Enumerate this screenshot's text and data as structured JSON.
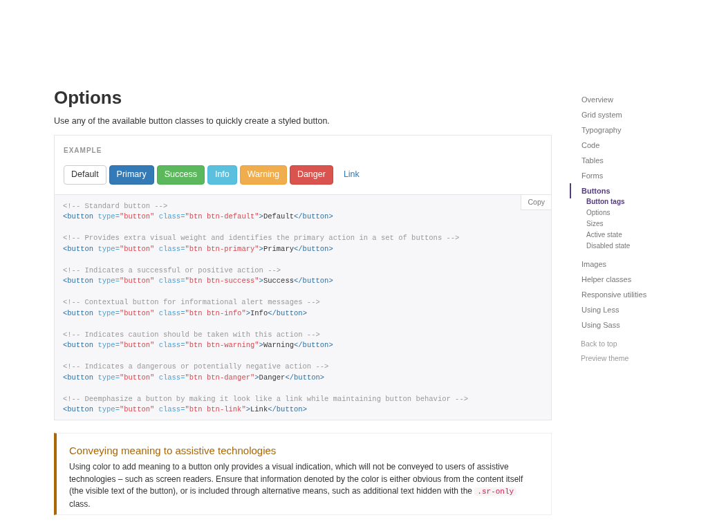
{
  "heading": "Options",
  "intro": "Use any of the available button classes to quickly create a styled button.",
  "example": {
    "label": "EXAMPLE",
    "buttons": [
      {
        "label": "Default",
        "kind": "default"
      },
      {
        "label": "Primary",
        "kind": "primary"
      },
      {
        "label": "Success",
        "kind": "success"
      },
      {
        "label": "Info",
        "kind": "info"
      },
      {
        "label": "Warning",
        "kind": "warning"
      },
      {
        "label": "Danger",
        "kind": "danger"
      },
      {
        "label": "Link",
        "kind": "link"
      }
    ]
  },
  "code": {
    "copy_label": "Copy",
    "blocks": [
      {
        "comment": "<!-- Standard button -->",
        "line": [
          {
            "kind": "tag",
            "text": "<button "
          },
          {
            "kind": "attr",
            "text": "type="
          },
          {
            "kind": "string",
            "text": "\"button\" "
          },
          {
            "kind": "attr",
            "text": "class="
          },
          {
            "kind": "string",
            "text": "\"btn btn-default\""
          },
          {
            "kind": "tag",
            "text": ">"
          },
          {
            "kind": "text",
            "text": "Default"
          },
          {
            "kind": "tag",
            "text": "</button>"
          }
        ]
      },
      {
        "comment": "<!-- Provides extra visual weight and identifies the primary action in a set of buttons -->",
        "line": [
          {
            "kind": "tag",
            "text": "<button "
          },
          {
            "kind": "attr",
            "text": "type="
          },
          {
            "kind": "string",
            "text": "\"button\" "
          },
          {
            "kind": "attr",
            "text": "class="
          },
          {
            "kind": "string",
            "text": "\"btn btn-primary\""
          },
          {
            "kind": "tag",
            "text": ">"
          },
          {
            "kind": "text",
            "text": "Primary"
          },
          {
            "kind": "tag",
            "text": "</button>"
          }
        ]
      },
      {
        "comment": "<!-- Indicates a successful or positive action -->",
        "line": [
          {
            "kind": "tag",
            "text": "<button "
          },
          {
            "kind": "attr",
            "text": "type="
          },
          {
            "kind": "string",
            "text": "\"button\" "
          },
          {
            "kind": "attr",
            "text": "class="
          },
          {
            "kind": "string",
            "text": "\"btn btn-success\""
          },
          {
            "kind": "tag",
            "text": ">"
          },
          {
            "kind": "text",
            "text": "Success"
          },
          {
            "kind": "tag",
            "text": "</button>"
          }
        ]
      },
      {
        "comment": "<!-- Contextual button for informational alert messages -->",
        "line": [
          {
            "kind": "tag",
            "text": "<button "
          },
          {
            "kind": "attr",
            "text": "type="
          },
          {
            "kind": "string",
            "text": "\"button\" "
          },
          {
            "kind": "attr",
            "text": "class="
          },
          {
            "kind": "string",
            "text": "\"btn btn-info\""
          },
          {
            "kind": "tag",
            "text": ">"
          },
          {
            "kind": "text",
            "text": "Info"
          },
          {
            "kind": "tag",
            "text": "</button>"
          }
        ]
      },
      {
        "comment": "<!-- Indicates caution should be taken with this action -->",
        "line": [
          {
            "kind": "tag",
            "text": "<button "
          },
          {
            "kind": "attr",
            "text": "type="
          },
          {
            "kind": "string",
            "text": "\"button\" "
          },
          {
            "kind": "attr",
            "text": "class="
          },
          {
            "kind": "string",
            "text": "\"btn btn-warning\""
          },
          {
            "kind": "tag",
            "text": ">"
          },
          {
            "kind": "text",
            "text": "Warning"
          },
          {
            "kind": "tag",
            "text": "</button>"
          }
        ]
      },
      {
        "comment": "<!-- Indicates a dangerous or potentially negative action -->",
        "line": [
          {
            "kind": "tag",
            "text": "<button "
          },
          {
            "kind": "attr",
            "text": "type="
          },
          {
            "kind": "string",
            "text": "\"button\" "
          },
          {
            "kind": "attr",
            "text": "class="
          },
          {
            "kind": "string",
            "text": "\"btn btn-danger\""
          },
          {
            "kind": "tag",
            "text": ">"
          },
          {
            "kind": "text",
            "text": "Danger"
          },
          {
            "kind": "tag",
            "text": "</button>"
          }
        ]
      },
      {
        "comment": "<!-- Deemphasize a button by making it look like a link while maintaining button behavior -->",
        "line": [
          {
            "kind": "tag",
            "text": "<button "
          },
          {
            "kind": "attr",
            "text": "type="
          },
          {
            "kind": "string",
            "text": "\"button\" "
          },
          {
            "kind": "attr",
            "text": "class="
          },
          {
            "kind": "string",
            "text": "\"btn btn-link\""
          },
          {
            "kind": "tag",
            "text": ">"
          },
          {
            "kind": "text",
            "text": "Link"
          },
          {
            "kind": "tag",
            "text": "</button>"
          }
        ]
      }
    ]
  },
  "callout": {
    "title": "Conveying meaning to assistive technologies",
    "text_before": "Using color to add meaning to a button only provides a visual indication, which will not be conveyed to users of assistive technologies – such as screen readers. Ensure that information denoted by the color is either obvious from the content itself (the visible text of the button), or is included through alternative means, such as additional text hidden with the",
    "code": ".sr-only",
    "text_after": "class."
  },
  "sidebar": {
    "items": [
      {
        "label": "Overview",
        "selected": false
      },
      {
        "label": "Grid system",
        "selected": false
      },
      {
        "label": "Typography",
        "selected": false
      },
      {
        "label": "Code",
        "selected": false
      },
      {
        "label": "Tables",
        "selected": false
      },
      {
        "label": "Forms",
        "selected": false
      },
      {
        "label": "Buttons",
        "selected": true,
        "children": [
          {
            "label": "Button tags",
            "selected": true
          },
          {
            "label": "Options",
            "selected": false
          },
          {
            "label": "Sizes",
            "selected": false
          },
          {
            "label": "Active state",
            "selected": false
          },
          {
            "label": "Disabled state",
            "selected": false
          }
        ]
      },
      {
        "label": "Images",
        "selected": false
      },
      {
        "label": "Helper classes",
        "selected": false
      },
      {
        "label": "Responsive utilities",
        "selected": false
      },
      {
        "label": "Using Less",
        "selected": false
      },
      {
        "label": "Using Sass",
        "selected": false
      }
    ],
    "links": [
      "Back to top",
      "Preview theme"
    ]
  }
}
